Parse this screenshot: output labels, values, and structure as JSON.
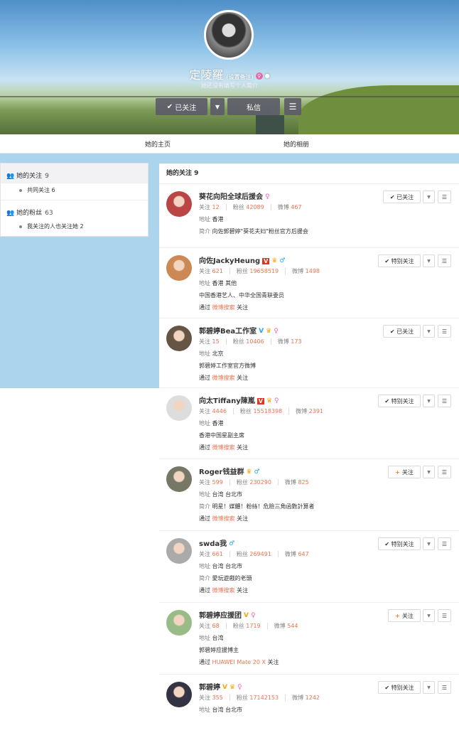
{
  "profile": {
    "name": "定陵羅",
    "remark": "(设置备注)",
    "bio": "她还没有填写个人简介",
    "followed_label": "已关注",
    "message_label": "私信"
  },
  "tabs": [
    "她的主页",
    "她的相册"
  ],
  "sidebar": {
    "following": {
      "label": "她的关注",
      "count": "9",
      "sub": "共同关注 6"
    },
    "fans": {
      "label": "她的粉丝",
      "count": "63",
      "sub": "我关注的人也关注她 2"
    }
  },
  "list_title": "她的关注 9",
  "labels": {
    "follow": "关注",
    "fans": "粉丝",
    "weibo": "微博",
    "addr": "地址",
    "intro": "简介",
    "via": "通过",
    "via_suffix": "关注"
  },
  "colors": {
    "accent": "#eb7350",
    "blue_bg": "#acd4ec"
  },
  "users": [
    {
      "name": "葵花向阳全球后援会",
      "badges": [
        "female"
      ],
      "follow": "12",
      "fans": "42089",
      "weibo": "467",
      "addr": "香港",
      "intro_label": true,
      "intro": "向佐郭碧婷\"葵花夫妇\"粉丝官方后援会",
      "via": "",
      "button": "已关注",
      "btype": "followed"
    },
    {
      "name": "向佐JackyHeung",
      "badges": [
        "v-red",
        "crown",
        "male"
      ],
      "follow": "621",
      "fans": "19658519",
      "weibo": "1498",
      "addr": "香港 其他",
      "intro_label": false,
      "intro": "中国香港艺人、中华全国青联委员",
      "via": "微博搜索",
      "button": "特别关注",
      "btype": "special"
    },
    {
      "name": "郭碧婷Bea工作室",
      "badges": [
        "v-blue",
        "crown",
        "female"
      ],
      "follow": "15",
      "fans": "10406",
      "weibo": "173",
      "addr": "北京",
      "intro_label": false,
      "intro": "郭碧婷工作室官方微博",
      "via": "微博搜索",
      "button": "已关注",
      "btype": "followed"
    },
    {
      "name": "向太Tiffany陳嵐",
      "badges": [
        "v-red",
        "crown",
        "female"
      ],
      "follow": "4446",
      "fans": "15518398",
      "weibo": "2391",
      "addr": "香港",
      "intro_label": false,
      "intro": "香港中国星副主席",
      "via": "微博搜索",
      "button": "特别关注",
      "btype": "special"
    },
    {
      "name": "Roger钱益群",
      "badges": [
        "crown",
        "male"
      ],
      "follow": "599",
      "fans": "230290",
      "weibo": "825",
      "addr": "台湾 台北市",
      "intro_label": true,
      "intro": "明星！媒體！粉絲！危險三角函數計算者",
      "via": "微博搜索",
      "button": "关注",
      "btype": "add"
    },
    {
      "name": "swda我",
      "badges": [
        "male"
      ],
      "follow": "661",
      "fans": "269491",
      "weibo": "647",
      "addr": "台湾 台北市",
      "intro_label": true,
      "intro": "愛玩遊戲的老頭",
      "via": "微博搜索",
      "button": "特别关注",
      "btype": "special"
    },
    {
      "name": "郭碧婷应援团",
      "badges": [
        "v-gold",
        "female"
      ],
      "follow": "68",
      "fans": "1719",
      "weibo": "544",
      "addr": "台湾",
      "intro_label": false,
      "intro": "郭碧婷应援博主",
      "via": "HUAWEI Mate 20 X",
      "button": "关注",
      "btype": "add"
    },
    {
      "name": "郭碧婷",
      "badges": [
        "v-gold",
        "crown",
        "female"
      ],
      "follow": "355",
      "fans": "17142153",
      "weibo": "1242",
      "addr": "台湾 台北市",
      "intro_label": false,
      "intro": "",
      "via": "",
      "button": "特别关注",
      "btype": "special"
    }
  ]
}
